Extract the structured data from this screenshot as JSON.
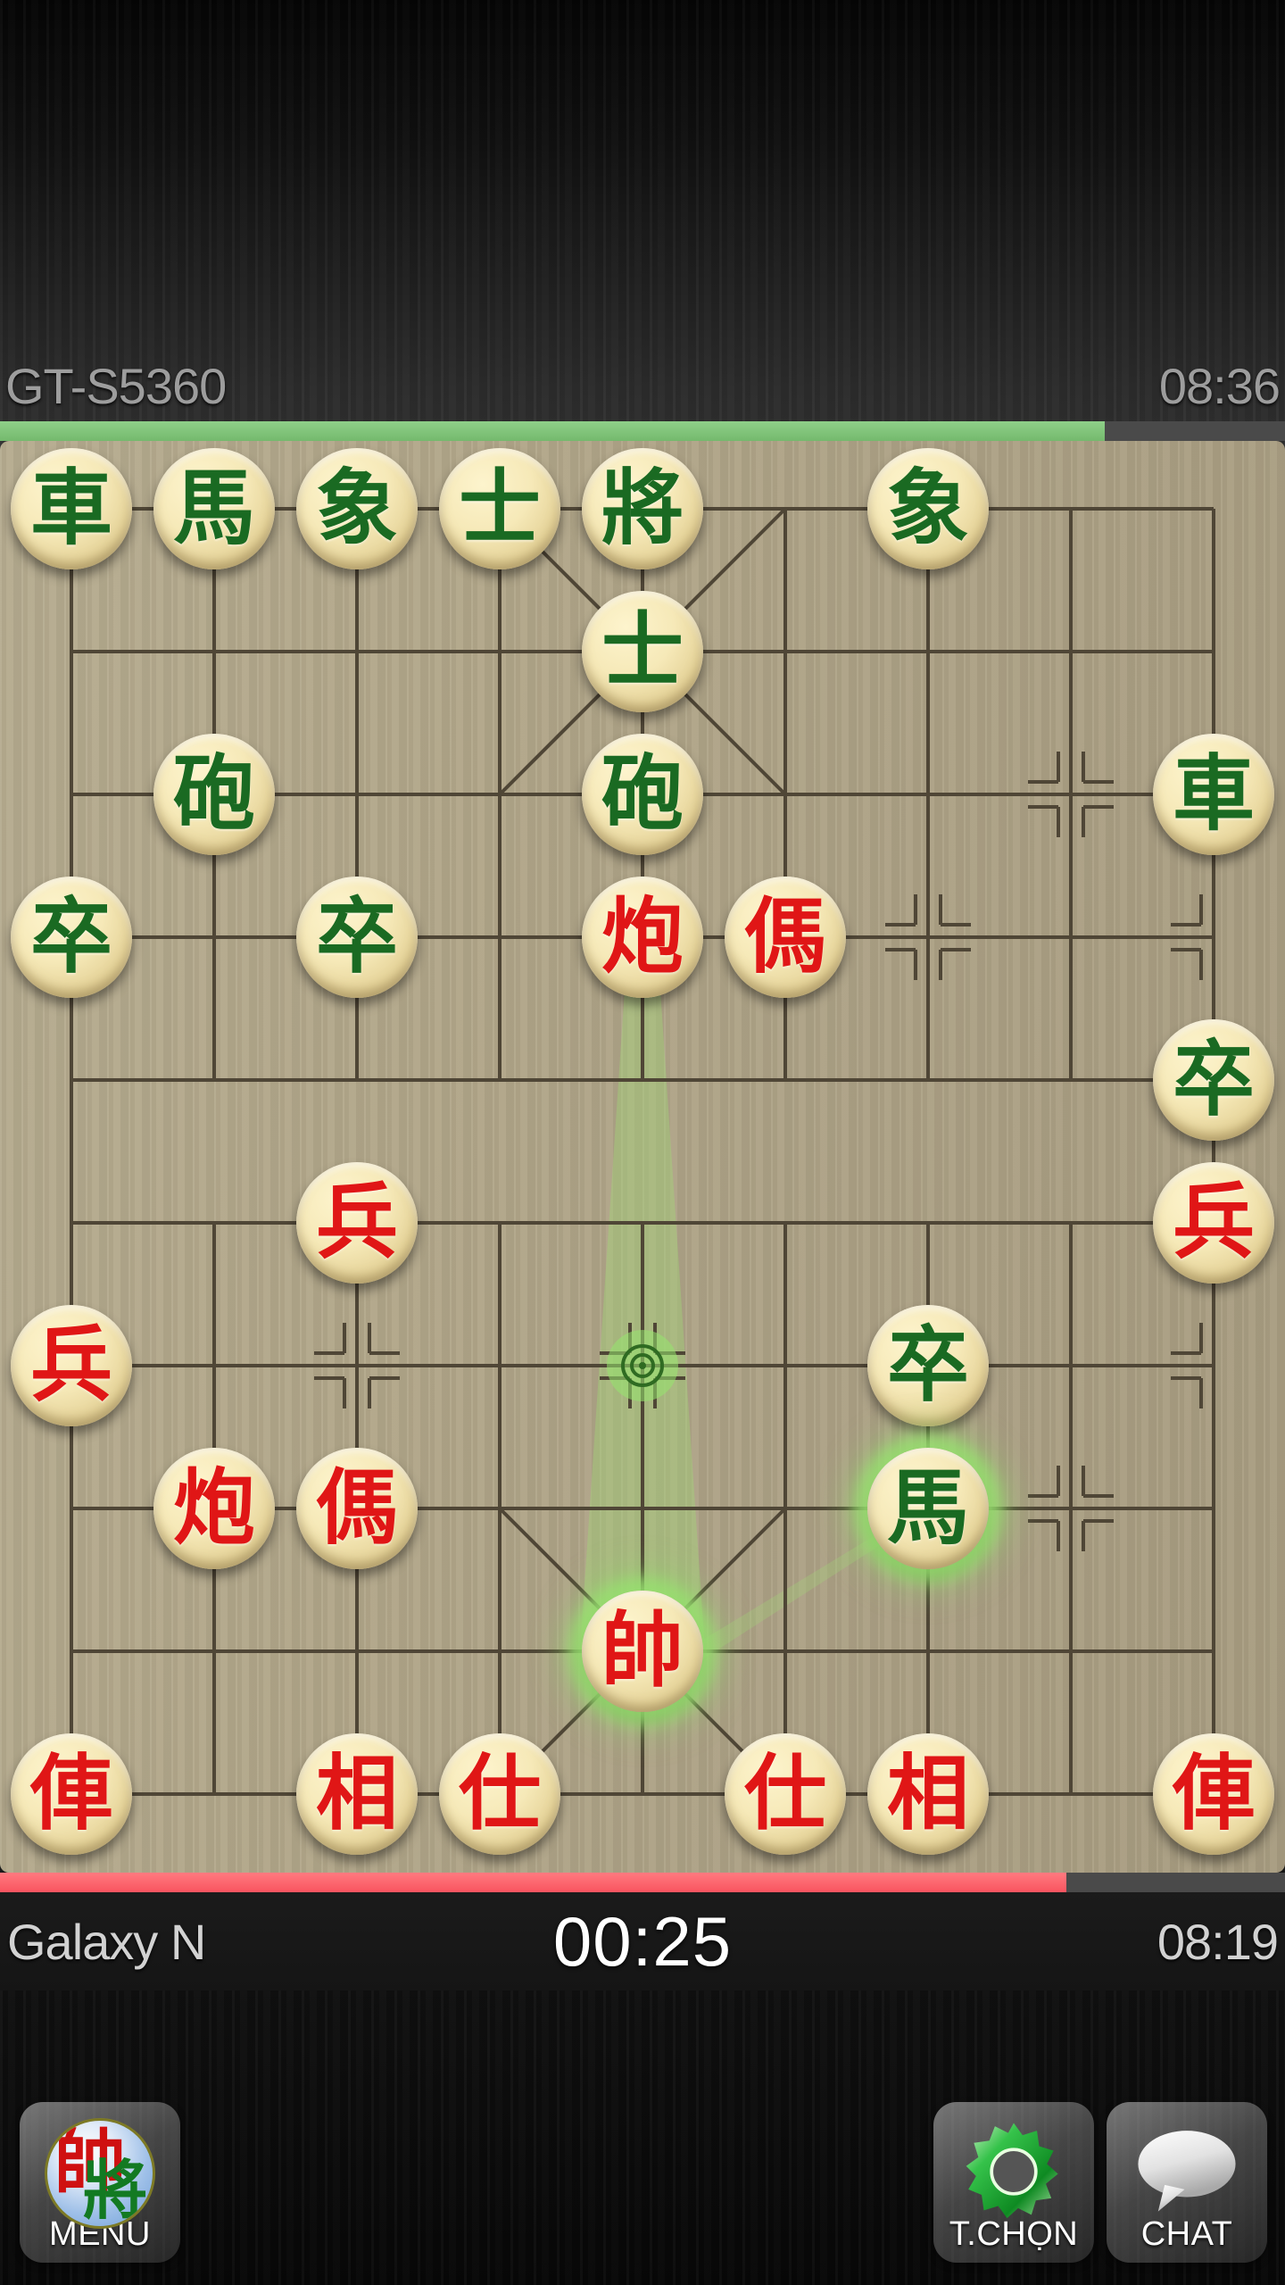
{
  "header": {
    "opponent_name": "GT-S5360",
    "opponent_clock": "08:36",
    "progress_percent": 86,
    "progress_color": "#7cc476"
  },
  "footer": {
    "player_name": "Galaxy N",
    "move_timer": "00:25",
    "player_clock": "08:19",
    "progress_percent": 83,
    "progress_color": "#f9545f"
  },
  "toolbar": {
    "menu": {
      "label": "MENU",
      "icon": "xiangqi-emblem-icon",
      "emblem_red": "帥",
      "emblem_green": "將"
    },
    "options": {
      "label": "T.CHỌN",
      "icon": "gear-icon",
      "icon_color": "#1fa83a"
    },
    "chat": {
      "label": "CHAT",
      "icon": "speech-bubble-icon",
      "icon_color": "#e8e8e8"
    }
  },
  "board": {
    "columns": 9,
    "rows": 10,
    "background_color": "#b0a68a",
    "line_color": "#4f4636",
    "selected_piece": {
      "col": 4,
      "row": 8,
      "glyph": "帥"
    },
    "target_marker": {
      "col": 4,
      "row": 6,
      "color": "#8fe06a"
    },
    "pieces": [
      {
        "col": 0,
        "row": 0,
        "glyph": "車",
        "side": "green"
      },
      {
        "col": 1,
        "row": 0,
        "glyph": "馬",
        "side": "green"
      },
      {
        "col": 2,
        "row": 0,
        "glyph": "象",
        "side": "green"
      },
      {
        "col": 3,
        "row": 0,
        "glyph": "士",
        "side": "green"
      },
      {
        "col": 4,
        "row": 0,
        "glyph": "將",
        "side": "green"
      },
      {
        "col": 6,
        "row": 0,
        "glyph": "象",
        "side": "green"
      },
      {
        "col": 4,
        "row": 1,
        "glyph": "士",
        "side": "green"
      },
      {
        "col": 1,
        "row": 2,
        "glyph": "砲",
        "side": "green"
      },
      {
        "col": 4,
        "row": 2,
        "glyph": "砲",
        "side": "green"
      },
      {
        "col": 8,
        "row": 2,
        "glyph": "車",
        "side": "green"
      },
      {
        "col": 0,
        "row": 3,
        "glyph": "卒",
        "side": "green"
      },
      {
        "col": 2,
        "row": 3,
        "glyph": "卒",
        "side": "green"
      },
      {
        "col": 4,
        "row": 3,
        "glyph": "炮",
        "side": "red"
      },
      {
        "col": 5,
        "row": 3,
        "glyph": "傌",
        "side": "red"
      },
      {
        "col": 8,
        "row": 4,
        "glyph": "卒",
        "side": "green"
      },
      {
        "col": 2,
        "row": 5,
        "glyph": "兵",
        "side": "red"
      },
      {
        "col": 8,
        "row": 5,
        "glyph": "兵",
        "side": "red"
      },
      {
        "col": 0,
        "row": 6,
        "glyph": "兵",
        "side": "red"
      },
      {
        "col": 6,
        "row": 6,
        "glyph": "卒",
        "side": "green"
      },
      {
        "col": 1,
        "row": 7,
        "glyph": "炮",
        "side": "red"
      },
      {
        "col": 2,
        "row": 7,
        "glyph": "傌",
        "side": "red"
      },
      {
        "col": 6,
        "row": 7,
        "glyph": "馬",
        "side": "green",
        "highlight": true
      },
      {
        "col": 4,
        "row": 8,
        "glyph": "帥",
        "side": "red",
        "highlight": true
      },
      {
        "col": 0,
        "row": 9,
        "glyph": "俥",
        "side": "red"
      },
      {
        "col": 2,
        "row": 9,
        "glyph": "相",
        "side": "red"
      },
      {
        "col": 3,
        "row": 9,
        "glyph": "仕",
        "side": "red"
      },
      {
        "col": 5,
        "row": 9,
        "glyph": "仕",
        "side": "red"
      },
      {
        "col": 6,
        "row": 9,
        "glyph": "相",
        "side": "red"
      },
      {
        "col": 8,
        "row": 9,
        "glyph": "俥",
        "side": "red"
      }
    ]
  }
}
